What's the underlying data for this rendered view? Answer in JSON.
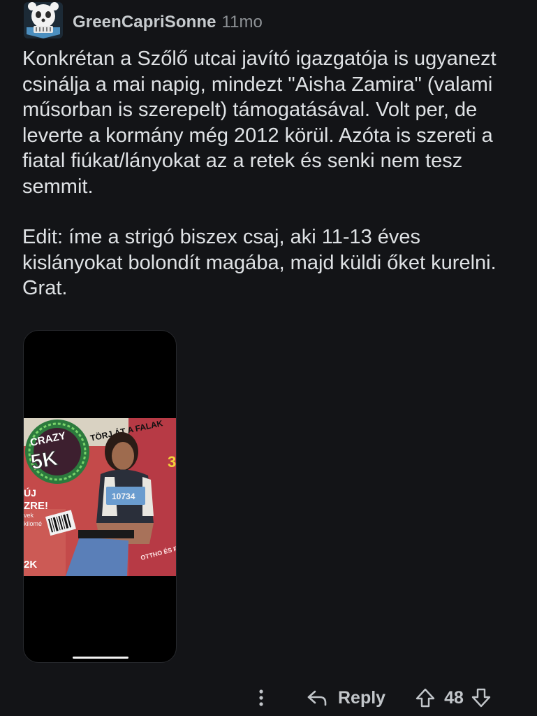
{
  "comment": {
    "author": "GreenCapriSonne",
    "age": "11mo",
    "paragraphs": [
      "Konkrétan a Szőlő utcai javító igazgatója is ugyanezt csinálja a mai napig, mindezt \"Aisha Zamira\" (valami műsorban is szerepelt) támogatásával. Volt per, de leverte a kormány még 2012 körül. Azóta is szereti a fiatal fiúkat/lányokat az a retek és senki nem tesz semmit.",
      "Edit: íme a strigó biszex csaj, aki 11-13 éves kislányokat bolondít magába, majd küldi őket kurelni. Grat."
    ]
  },
  "attachment": {
    "cover_texts": {
      "badge_top": "CRAZY",
      "badge_big": "5K",
      "headline": "TÖRJ ÁT A FALAK",
      "bib_number": "10734",
      "side_top": "ÚJ",
      "side_mid": "ZRE!",
      "side_small1": "vek",
      "side_small2": "kilomé",
      "side_bottom": "2K",
      "corner_right": "3",
      "bottom_right": "OTTHO ÉS PISZ"
    }
  },
  "actions": {
    "reply_label": "Reply",
    "vote_count": "48"
  },
  "colors": {
    "background": "#131417",
    "text": "#dfe2e5",
    "muted": "#8e9296"
  },
  "icons": {
    "avatar": "snoo-avatar-icon",
    "more": "more-options-icon",
    "reply": "reply-arrow-icon",
    "upvote": "upvote-arrow-icon",
    "downvote": "downvote-arrow-icon"
  }
}
